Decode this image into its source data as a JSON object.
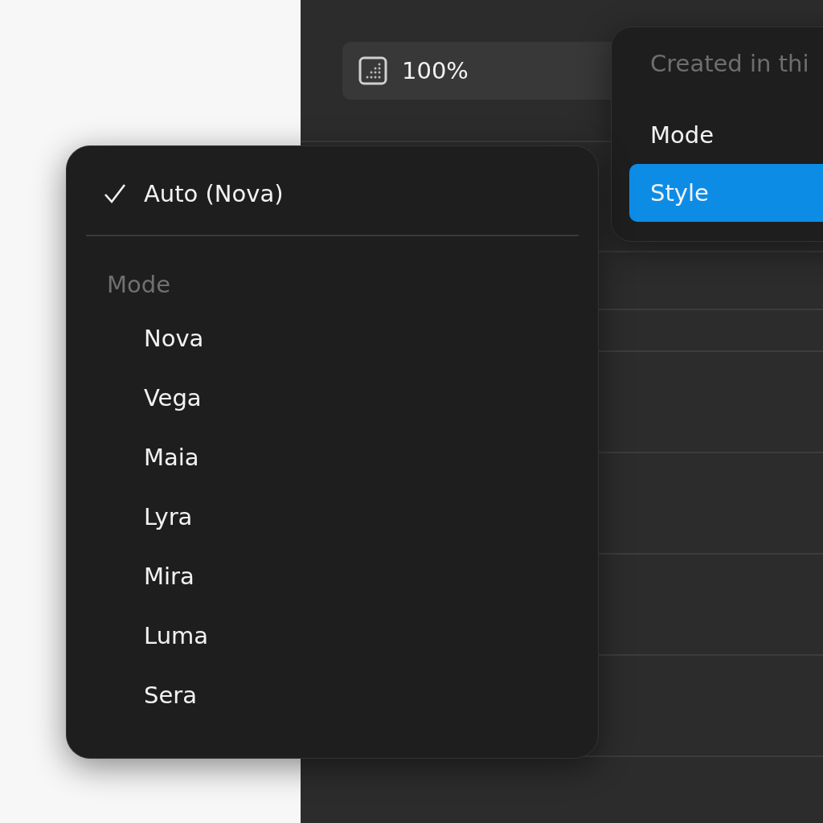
{
  "zoom_field": {
    "value": "100%"
  },
  "context_menu": {
    "header": "Created in thi",
    "items": [
      {
        "label": "Mode",
        "selected": false
      },
      {
        "label": "Style",
        "selected": true
      }
    ]
  },
  "dropdown": {
    "top_items": [
      {
        "label": "Auto (Nova)",
        "checked": true
      }
    ],
    "section": "Mode",
    "options": [
      {
        "label": "Nova",
        "checked": false
      },
      {
        "label": "Vega",
        "checked": false
      },
      {
        "label": "Maia",
        "checked": false
      },
      {
        "label": "Lyra",
        "checked": false
      },
      {
        "label": "Mira",
        "checked": false
      },
      {
        "label": "Luma",
        "checked": false
      },
      {
        "label": "Sera",
        "checked": false
      }
    ]
  }
}
